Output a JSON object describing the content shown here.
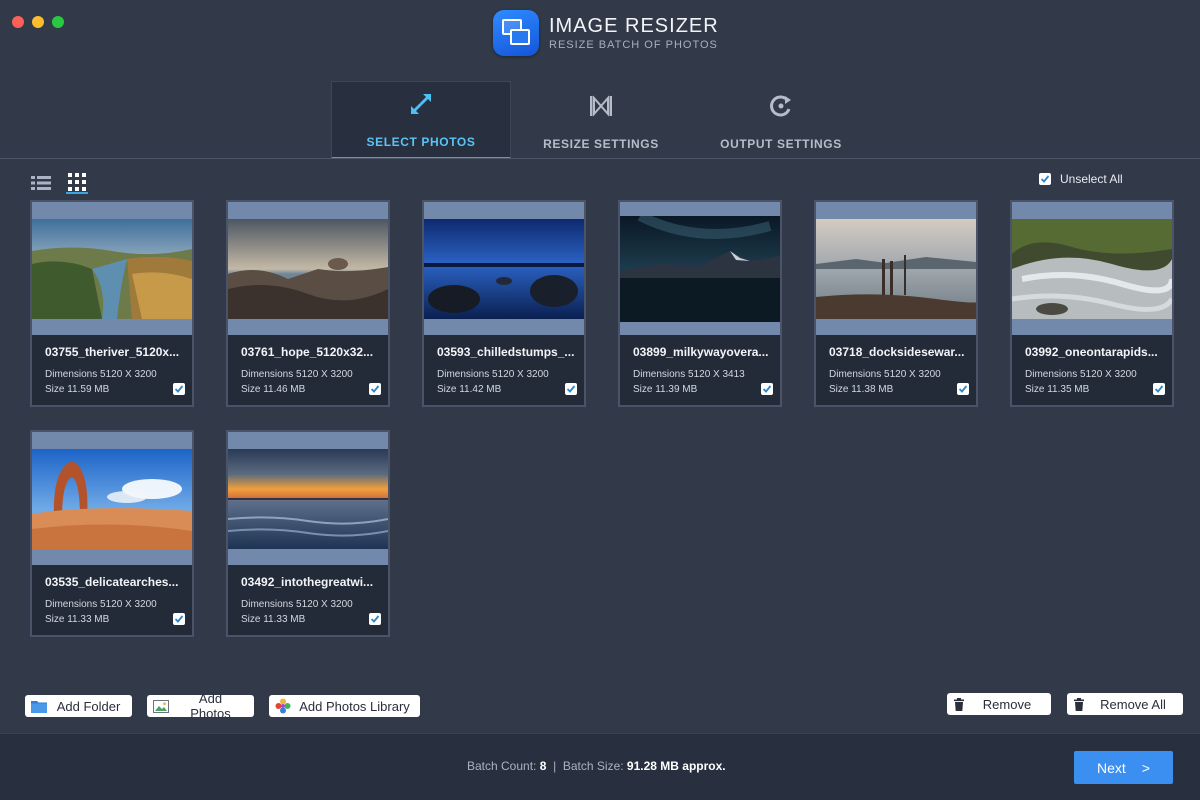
{
  "window": {
    "title": "IMAGE RESIZER",
    "subtitle": "RESIZE BATCH OF PHOTOS"
  },
  "tabs": [
    {
      "label": "SELECT PHOTOS",
      "icon": "expand-arrows-icon",
      "active": true
    },
    {
      "label": "RESIZE SETTINGS",
      "icon": "resize-bowtie-icon",
      "active": false
    },
    {
      "label": "OUTPUT SETTINGS",
      "icon": "output-cycle-icon",
      "active": false
    }
  ],
  "view_toggle": {
    "list_icon": "list-view-icon",
    "grid_icon": "grid-view-icon",
    "active": "grid"
  },
  "unselect_all": {
    "label": "Unselect All",
    "checked": true
  },
  "photos": [
    {
      "name": "03755_theriver_5120x...",
      "dimensions": "Dimensions 5120 X 3200",
      "size": "Size 11.59 MB",
      "checked": true
    },
    {
      "name": "03761_hope_5120x32...",
      "dimensions": "Dimensions 5120 X 3200",
      "size": "Size 11.46 MB",
      "checked": true
    },
    {
      "name": "03593_chilledstumps_...",
      "dimensions": "Dimensions 5120 X 3200",
      "size": "Size 11.42 MB",
      "checked": true
    },
    {
      "name": "03899_milkywayovera...",
      "dimensions": "Dimensions 5120 X 3413",
      "size": "Size 11.39 MB",
      "checked": true
    },
    {
      "name": "03718_docksidesewar...",
      "dimensions": "Dimensions 5120 X 3200",
      "size": "Size 11.38 MB",
      "checked": true
    },
    {
      "name": "03992_oneontarapids...",
      "dimensions": "Dimensions 5120 X 3200",
      "size": "Size 11.35 MB",
      "checked": true
    },
    {
      "name": "03535_delicatearches...",
      "dimensions": "Dimensions 5120 X 3200",
      "size": "Size 11.33 MB",
      "checked": true
    },
    {
      "name": "03492_intothegreatwi...",
      "dimensions": "Dimensions 5120 X 3200",
      "size": "Size 11.33 MB",
      "checked": true
    }
  ],
  "actions": {
    "add_folder": "Add Folder",
    "add_photos": "Add Photos",
    "add_photos_library": "Add Photos Library",
    "remove": "Remove",
    "remove_all": "Remove All"
  },
  "footer": {
    "batch_count_label": "Batch Count:",
    "batch_count": "8",
    "separator": "|",
    "batch_size_label": "Batch Size:",
    "batch_size": "91.28 MB",
    "batch_size_suffix": "approx.",
    "next_label": "Next",
    "next_chevron": ">"
  },
  "colors": {
    "accent": "#3aa8e0",
    "next_button": "#3a8ff0",
    "background": "#323a4a",
    "card": "#242b38"
  }
}
